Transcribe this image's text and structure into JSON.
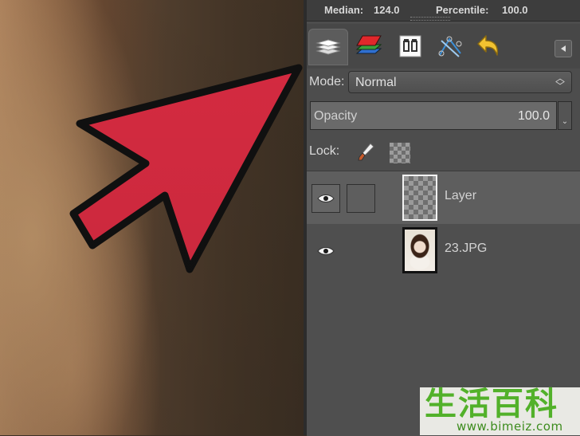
{
  "stats": {
    "median_label": "Median:",
    "median_value": "124.0",
    "percentile_label": "Percentile:",
    "percentile_value": "100.0"
  },
  "tabs": [
    {
      "icon": "layers-icon",
      "active": true
    },
    {
      "icon": "channels-icon",
      "active": false
    },
    {
      "icon": "paths-icon",
      "active": false
    },
    {
      "icon": "colormap-icon",
      "active": false
    },
    {
      "icon": "undo-history-icon",
      "active": false
    }
  ],
  "tab_menu_icon": "triangle-left-icon",
  "mode": {
    "label": "Mode:",
    "value": "Normal"
  },
  "opacity": {
    "label": "Opacity",
    "value": "100.0"
  },
  "lock": {
    "label": "Lock:",
    "icons": [
      "paintbrush-icon",
      "alpha-lock-icon"
    ]
  },
  "layers": [
    {
      "name": "Layer",
      "visible": true,
      "selected": true,
      "thumbnail": "transparent"
    },
    {
      "name": "23.JPG",
      "visible": true,
      "selected": false,
      "thumbnail": "photo"
    }
  ],
  "watermark": {
    "chinese": "生活百科",
    "url": "www.bimeiz.com"
  },
  "colors": {
    "arrow": "#e12d44",
    "panel_bg": "#4d4d4d",
    "watermark_green": "#52b12a"
  }
}
